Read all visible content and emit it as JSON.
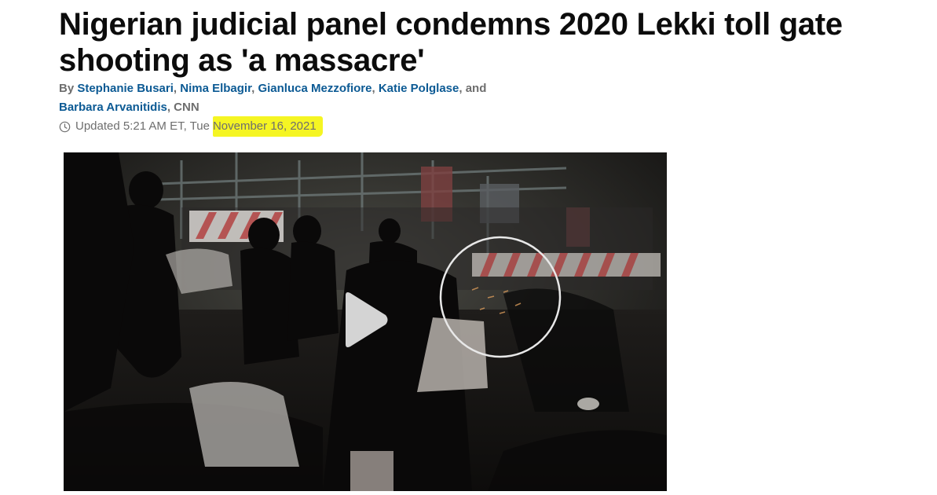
{
  "article": {
    "headline_line1": "Nigerian judicial panel condemns 2020 Lekki toll gate",
    "headline_line2": "shooting as 'a massacre'",
    "byline": {
      "prefix": "By ",
      "authors": [
        "Stephanie Busari",
        "Nima Elbagir",
        "Gianluca Mezzofiore",
        "Katie Polglase",
        "Barbara Arvanitidis"
      ],
      "separator": ", ",
      "and": ", and",
      "source": ", CNN"
    },
    "timestamp": {
      "icon": "clock-icon",
      "prefix": "Updated 5:21 AM ET, Tue",
      "date": "November 16, 2021"
    }
  },
  "video": {
    "play_icon": "play-icon",
    "circle_annotation": "circle-annotation"
  },
  "colors": {
    "headline": "#0c0c0c",
    "author_link": "#0c5a94",
    "meta_text": "#6e6e6e",
    "highlight": "#f5f523",
    "video_bg": "#141211"
  }
}
